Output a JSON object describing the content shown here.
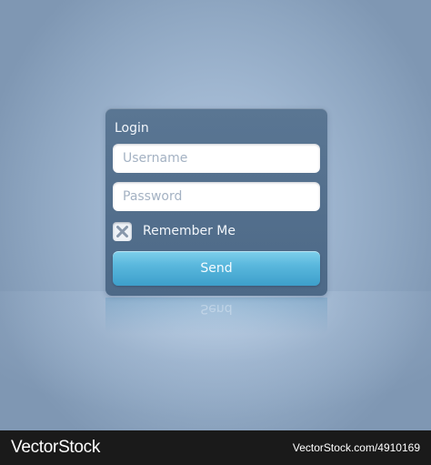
{
  "login_panel": {
    "title": "Login",
    "username_placeholder": "Username",
    "password_placeholder": "Password",
    "remember_label": "Remember Me",
    "remember_checked": true,
    "submit_label": "Send"
  },
  "colors": {
    "panel": "#56728f",
    "button": "#5ab8dd",
    "background": "#9fb6d0"
  },
  "footer": {
    "logo": "VectorStock",
    "image_id": "VectorStock.com/4910169"
  }
}
